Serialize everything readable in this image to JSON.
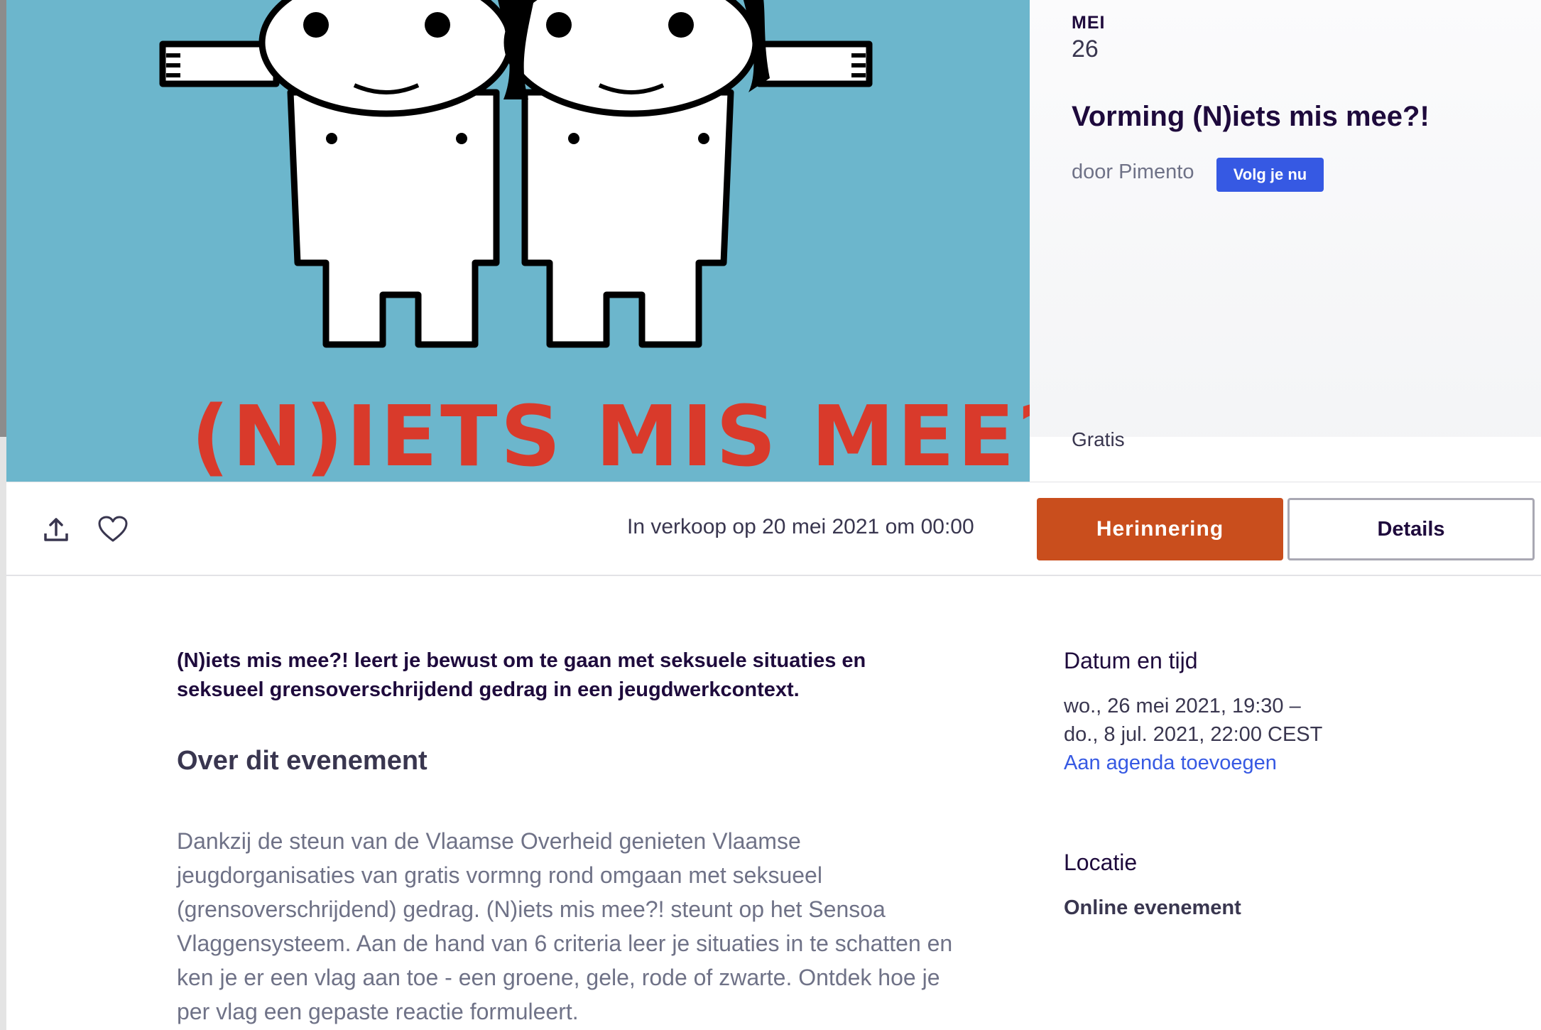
{
  "hero": {
    "image_title": "(N)IETS MIS MEE?!",
    "image_background": "#6cb6cc",
    "image_title_color": "#d93a2b"
  },
  "event": {
    "month": "MEI",
    "day": "26",
    "title": "Vorming (N)iets mis mee?!",
    "organizer": "door Pimento",
    "follow_label": "Volg je nu",
    "price": "Gratis"
  },
  "actions": {
    "share_icon": "share-icon",
    "like_icon": "heart-icon",
    "sale_text": "In verkoop op 20 mei 2021 om 00:00",
    "reminder_label": "Herinnering",
    "details_label": "Details"
  },
  "content": {
    "summary": "(N)iets mis mee?! leert je bewust om te gaan met seksuele situaties en seksueel grensoverschrijdend gedrag in een jeugdwerkcontext.",
    "about_heading": "Over dit evenement",
    "description": "Dankzij de steun van de Vlaamse Overheid genieten Vlaamse jeugdorganisaties van gratis vormng rond omgaan met seksueel (grensoverschrijdend) gedrag. (N)iets mis mee?! steunt op het Sensoa Vlaggensysteem. Aan de hand van 6 criteria leer je situaties in te schatten en ken je er een vlag aan toe - een groene, gele, rode of zwarte. Ontdek hoe je per vlag een gepaste reactie formuleert."
  },
  "sidebar": {
    "datetime_heading": "Datum en tijd",
    "datetime_line1": "wo., 26 mei 2021, 19:30 –",
    "datetime_line2": "do., 8 jul. 2021, 22:00 CEST",
    "calendar_link": "Aan agenda toevoegen",
    "location_heading": "Locatie",
    "location_value": "Online evenement"
  },
  "colors": {
    "brand_orange": "#c94e1d",
    "link_blue": "#3659e3",
    "text_dark": "#1e0a3c"
  }
}
